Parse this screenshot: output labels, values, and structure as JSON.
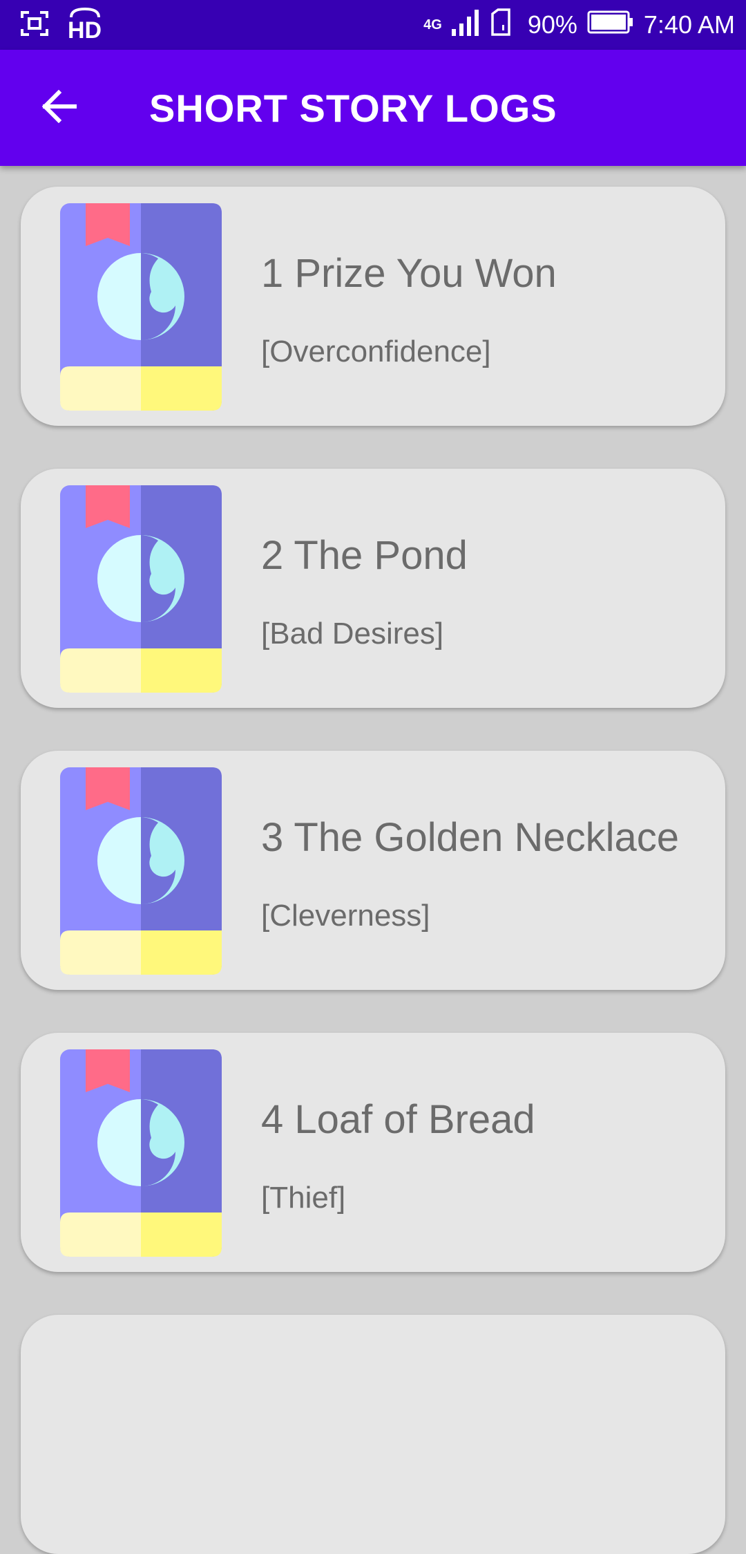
{
  "status_bar": {
    "hd_label": "HD",
    "network_label": "4G",
    "battery_percent": "90%",
    "time": "7:40 AM",
    "icons": [
      "screenshot-icon",
      "hd-voice-icon",
      "signal-icon",
      "sim-icon",
      "battery-icon"
    ]
  },
  "app_bar": {
    "title": "SHORT STORY LOGS",
    "back_icon": "arrow-left-icon",
    "background_color": "#6200ee"
  },
  "stories": [
    {
      "title": "1 Prize You Won",
      "moral": "[Overconfidence]"
    },
    {
      "title": "2 The Pond",
      "moral": "[Bad Desires]"
    },
    {
      "title": "3 The Golden Necklace",
      "moral": "[Cleverness]"
    },
    {
      "title": "4 Loaf of Bread",
      "moral": "[Thief]"
    }
  ]
}
